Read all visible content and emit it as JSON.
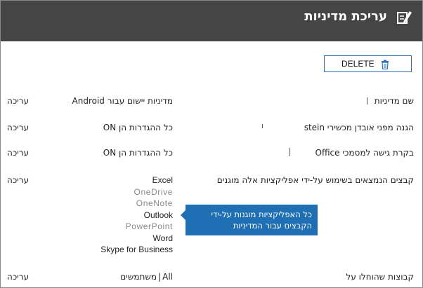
{
  "header": {
    "title": "עריכת מדיניות",
    "icon": "edit-policy-icon"
  },
  "toolbar": {
    "delete_label": "DELETE",
    "delete_icon": "trash-icon"
  },
  "rows": [
    {
      "label": "שם מדיניות",
      "value": "מדיניות יישום עבור Android",
      "edit": "עריכה"
    },
    {
      "label": "הגנה מפני אובדן מכשירי stein",
      "value": "כל ההגדרות הן ON",
      "edit": "עריכה"
    },
    {
      "label": "בקרת גישה למסמכי Office",
      "value": "כל ההגדרות הן ON",
      "edit": "עריכה"
    },
    {
      "label": "קבצים הנמצאים בשימוש על-ידי אפליקציות אלה מוגנים",
      "edit": "עריכה"
    },
    {
      "label": "קבוצות שהוחלו על",
      "value_prefix": "All",
      "value_suffix": "משתמשים",
      "edit": "עריכה"
    }
  ],
  "apps": [
    "Excel",
    "OneDrive",
    "OneNote",
    "Outlook",
    "PowerPoint",
    "Word",
    "Skype for Business"
  ],
  "callout": {
    "text": "כל האפליקציות מוגנות על-ידי הקבצים עבור המדיניות"
  },
  "colors": {
    "header_bg": "#454545",
    "accent": "#1f6fb5",
    "button_border": "#2d72b8"
  }
}
